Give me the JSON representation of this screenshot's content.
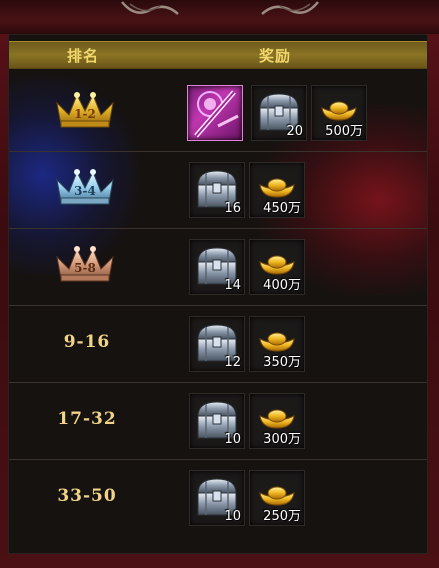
{
  "header": {
    "rank_label": "排名",
    "reward_label": "奖励"
  },
  "colors": {
    "accent_gold": "#f1d76c",
    "panel_bg": "#161210",
    "frame_red": "#5a1218"
  },
  "rows": [
    {
      "rank": "1-2",
      "badge": "gold-crown-icon",
      "rewards": [
        {
          "icon": "purple-equipment-icon",
          "count": ""
        },
        {
          "icon": "silver-chest-icon",
          "count": "20"
        },
        {
          "icon": "gold-ingot-icon",
          "count": "500万"
        }
      ]
    },
    {
      "rank": "3-4",
      "badge": "silver-crown-icon",
      "rewards": [
        {
          "icon": "silver-chest-icon",
          "count": "16"
        },
        {
          "icon": "gold-ingot-icon",
          "count": "450万"
        }
      ]
    },
    {
      "rank": "5-8",
      "badge": "bronze-crown-icon",
      "rewards": [
        {
          "icon": "silver-chest-icon",
          "count": "14"
        },
        {
          "icon": "gold-ingot-icon",
          "count": "400万"
        }
      ]
    },
    {
      "rank": "9-16",
      "rewards": [
        {
          "icon": "silver-chest-icon",
          "count": "12"
        },
        {
          "icon": "gold-ingot-icon",
          "count": "350万"
        }
      ]
    },
    {
      "rank": "17-32",
      "rewards": [
        {
          "icon": "silver-chest-icon",
          "count": "10"
        },
        {
          "icon": "gold-ingot-icon",
          "count": "300万"
        }
      ]
    },
    {
      "rank": "33-50",
      "rewards": [
        {
          "icon": "silver-chest-icon",
          "count": "10"
        },
        {
          "icon": "gold-ingot-icon",
          "count": "250万"
        }
      ]
    }
  ]
}
